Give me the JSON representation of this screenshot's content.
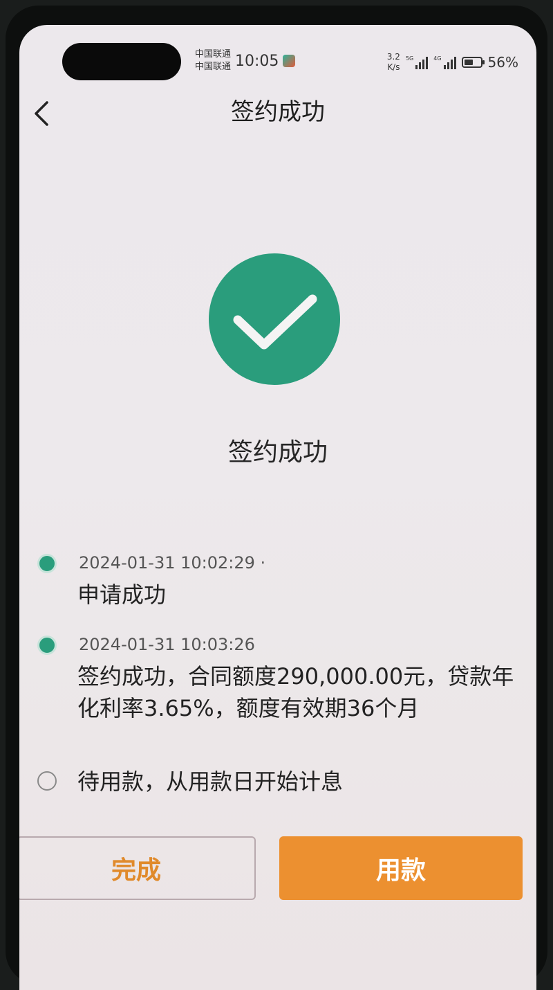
{
  "status_bar": {
    "carrier_1": "中国联通",
    "carrier_2": "中国联通",
    "time": "10:05",
    "speed_value": "3.2",
    "speed_unit": "K/s",
    "sim1_network": "5G",
    "sim2_network": "4G",
    "battery_percent": "56%",
    "battery_level": 0.56
  },
  "header": {
    "title": "签约成功",
    "back_icon": "chevron-left-icon"
  },
  "result": {
    "icon": "check-circle-icon",
    "icon_color": "#2a9d7c",
    "text": "签约成功"
  },
  "timeline": [
    {
      "time": "2024-01-31 10:02:29 ·",
      "text": "申请成功",
      "status": "done"
    },
    {
      "time": "2024-01-31 10:03:26",
      "text": "签约成功，合同额度290,000.00元，贷款年化利率3.65%，额度有效期36个月",
      "status": "done"
    },
    {
      "time": "",
      "text": "待用款，从用款日开始计息",
      "status": "pending"
    }
  ],
  "actions": {
    "done_label": "完成",
    "use_label": "用款",
    "accent_color": "#ec9030"
  }
}
